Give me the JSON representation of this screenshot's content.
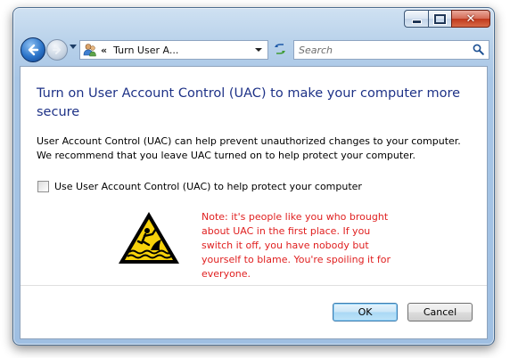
{
  "window": {
    "caption_buttons": {
      "minimize_icon": "minimize-icon",
      "maximize_icon": "maximize-icon",
      "close_glyph": "✕"
    }
  },
  "navigation": {
    "address_chevron": "«",
    "address_text": "Turn User A...",
    "search_placeholder": "Search"
  },
  "main": {
    "title": "Turn on User Account Control (UAC) to make your computer more secure",
    "description": "User Account Control (UAC) can help prevent unauthorized changes to your computer. We recommend that you leave UAC turned on to help protect your computer.",
    "checkbox_label": "Use User Account Control (UAC) to help protect your computer",
    "checkbox_checked": false,
    "note": "Note: it's people like you who brought about UAC in the first place. If you switch it off, you have nobody but yourself to blame. You're spoiling it for everyone."
  },
  "buttons": {
    "ok": "OK",
    "cancel": "Cancel"
  },
  "colors": {
    "title": "#1e3287",
    "note": "#e02020",
    "warning_yellow": "#f6d10a"
  }
}
